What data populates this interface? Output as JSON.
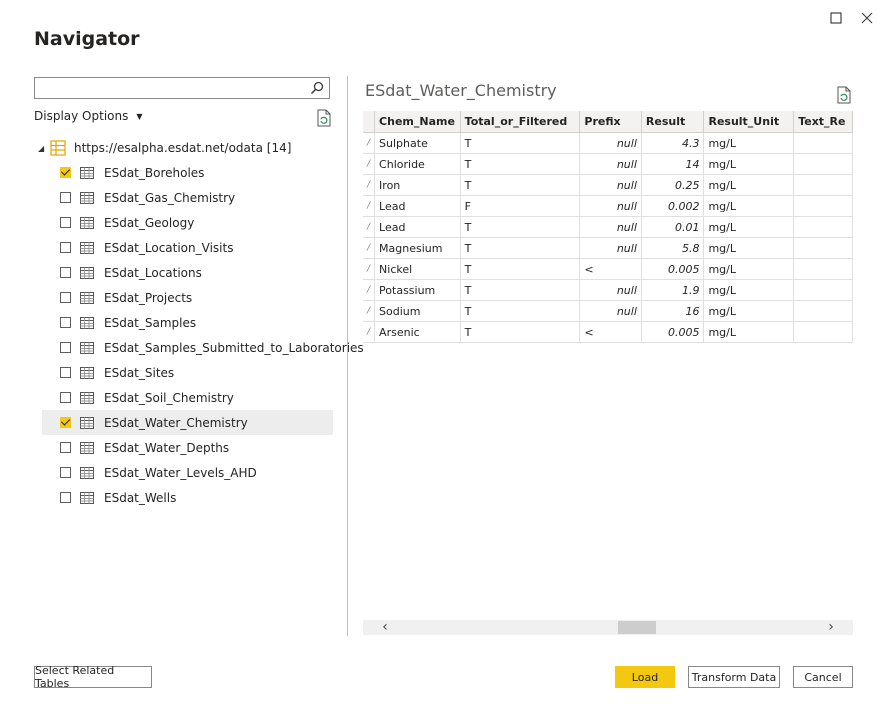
{
  "window": {
    "title": "Navigator"
  },
  "search": {
    "value": ""
  },
  "display_options": {
    "label": "Display Options"
  },
  "tree": {
    "root_label": "https://esalpha.esdat.net/odata [14]",
    "items": [
      {
        "label": "ESdat_Boreholes",
        "checked": true,
        "selected": false
      },
      {
        "label": "ESdat_Gas_Chemistry",
        "checked": false,
        "selected": false
      },
      {
        "label": "ESdat_Geology",
        "checked": false,
        "selected": false
      },
      {
        "label": "ESdat_Location_Visits",
        "checked": false,
        "selected": false
      },
      {
        "label": "ESdat_Locations",
        "checked": false,
        "selected": false
      },
      {
        "label": "ESdat_Projects",
        "checked": false,
        "selected": false
      },
      {
        "label": "ESdat_Samples",
        "checked": false,
        "selected": false
      },
      {
        "label": "ESdat_Samples_Submitted_to_Laboratories",
        "checked": false,
        "selected": false
      },
      {
        "label": "ESdat_Sites",
        "checked": false,
        "selected": false
      },
      {
        "label": "ESdat_Soil_Chemistry",
        "checked": false,
        "selected": false
      },
      {
        "label": "ESdat_Water_Chemistry",
        "checked": true,
        "selected": true
      },
      {
        "label": "ESdat_Water_Depths",
        "checked": false,
        "selected": false
      },
      {
        "label": "ESdat_Water_Levels_AHD",
        "checked": false,
        "selected": false
      },
      {
        "label": "ESdat_Wells",
        "checked": false,
        "selected": false
      }
    ]
  },
  "preview": {
    "title": "ESdat_Water_Chemistry",
    "columns": [
      "Chem_Name",
      "Total_or_Filtered",
      "Prefix",
      "Result",
      "Result_Unit",
      "Text_Re"
    ],
    "rows": [
      [
        "Sulphate",
        "T",
        "null",
        "4.3",
        "mg/L",
        ""
      ],
      [
        "Chloride",
        "T",
        "null",
        "14",
        "mg/L",
        ""
      ],
      [
        "Iron",
        "T",
        "null",
        "0.25",
        "mg/L",
        ""
      ],
      [
        "Lead",
        "F",
        "null",
        "0.002",
        "mg/L",
        ""
      ],
      [
        "Lead",
        "T",
        "null",
        "0.01",
        "mg/L",
        ""
      ],
      [
        "Magnesium",
        "T",
        "null",
        "5.8",
        "mg/L",
        ""
      ],
      [
        "Nickel",
        "T",
        "<",
        "0.005",
        "mg/L",
        ""
      ],
      [
        "Potassium",
        "T",
        "null",
        "1.9",
        "mg/L",
        ""
      ],
      [
        "Sodium",
        "T",
        "null",
        "16",
        "mg/L",
        ""
      ],
      [
        "Arsenic",
        "T",
        "<",
        "0.005",
        "mg/L",
        ""
      ]
    ]
  },
  "buttons": {
    "select_related": "Select Related Tables",
    "load": "Load",
    "transform": "Transform Data",
    "cancel": "Cancel"
  },
  "colors": {
    "accent": "#f2c811",
    "selected_row": "#ededed"
  }
}
